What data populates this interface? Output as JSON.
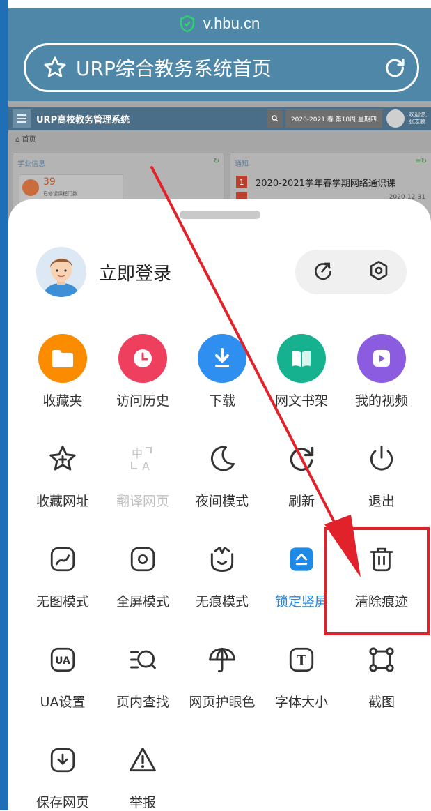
{
  "browser": {
    "domain": "v.hbu.cn",
    "page_title": "URP综合教务系统首页"
  },
  "webpage": {
    "brand": "URP高校教务管理系统",
    "term": "2020-2021 春 第18周 星期四",
    "welcome": "欢迎您, 张志鹏",
    "breadcrumb": "首页",
    "panel_left_title": "学业信息",
    "stat_number": "39",
    "stat_label": "已修读课程门数",
    "panel_right_title": "通知",
    "notice_index": "1",
    "notice_text": "2020-2021学年春学期网络通识课",
    "notice_date": "2020-12-31"
  },
  "sheet": {
    "login_label": "立即登录",
    "row1": [
      {
        "label": "收藏夹",
        "icon": "folder-icon",
        "color": "#fb8c00"
      },
      {
        "label": "访问历史",
        "icon": "clock-icon",
        "color": "#ef3f5f"
      },
      {
        "label": "下载",
        "icon": "download-icon",
        "color": "#2f8ff0"
      },
      {
        "label": "网文书架",
        "icon": "book-icon",
        "color": "#16b18f"
      },
      {
        "label": "我的视频",
        "icon": "video-icon",
        "color": "#8b5ce0"
      }
    ],
    "row2": [
      {
        "label": "收藏网址",
        "icon": "star-plus-icon"
      },
      {
        "label": "翻译网页",
        "icon": "translate-icon"
      },
      {
        "label": "夜间模式",
        "icon": "moon-icon"
      },
      {
        "label": "刷新",
        "icon": "refresh-icon"
      },
      {
        "label": "退出",
        "icon": "power-icon"
      }
    ],
    "row3": [
      {
        "label": "无图模式",
        "icon": "no-image-icon"
      },
      {
        "label": "全屏模式",
        "icon": "fullscreen-icon"
      },
      {
        "label": "无痕模式",
        "icon": "incognito-icon"
      },
      {
        "label": "锁定竖屏",
        "icon": "lock-portrait-icon"
      },
      {
        "label": "清除痕迹",
        "icon": "trash-icon"
      }
    ],
    "row4": [
      {
        "label": "UA设置",
        "icon": "ua-icon",
        "badge": "UA"
      },
      {
        "label": "页内查找",
        "icon": "find-in-page-icon"
      },
      {
        "label": "网页护眼色",
        "icon": "umbrella-icon"
      },
      {
        "label": "字体大小",
        "icon": "font-size-icon",
        "badge": "T"
      },
      {
        "label": "截图",
        "icon": "screenshot-icon"
      }
    ],
    "row5": [
      {
        "label": "保存网页",
        "icon": "save-page-icon"
      },
      {
        "label": "举报",
        "icon": "report-icon"
      }
    ]
  },
  "annotation": {
    "color": "#e2222b"
  }
}
